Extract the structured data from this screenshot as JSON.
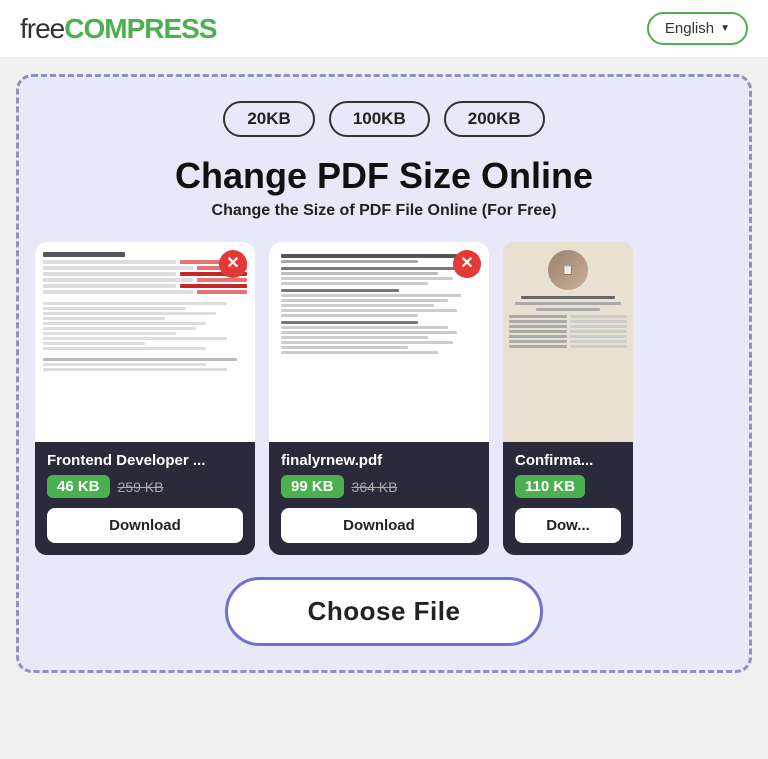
{
  "header": {
    "logo_free": "free",
    "logo_compress": "COMPRESS",
    "lang_label": "English",
    "lang_chevron": "▼"
  },
  "size_badges": [
    "20KB",
    "100KB",
    "200KB"
  ],
  "main_title": "Change PDF Size Online",
  "sub_title": "Change the Size of PDF File Online (For Free)",
  "cards": [
    {
      "filename": "Frontend Developer ...",
      "new_size": "46 KB",
      "old_size": "259 KB",
      "download_label": "Download",
      "type": "doc1"
    },
    {
      "filename": "finalyrnew.pdf",
      "new_size": "99 KB",
      "old_size": "364 KB",
      "download_label": "Download",
      "type": "doc2"
    },
    {
      "filename": "Confirma...",
      "new_size": "110 KB",
      "old_size": "",
      "download_label": "Dow...",
      "type": "confirm"
    }
  ],
  "choose_file_label": "Choose File"
}
